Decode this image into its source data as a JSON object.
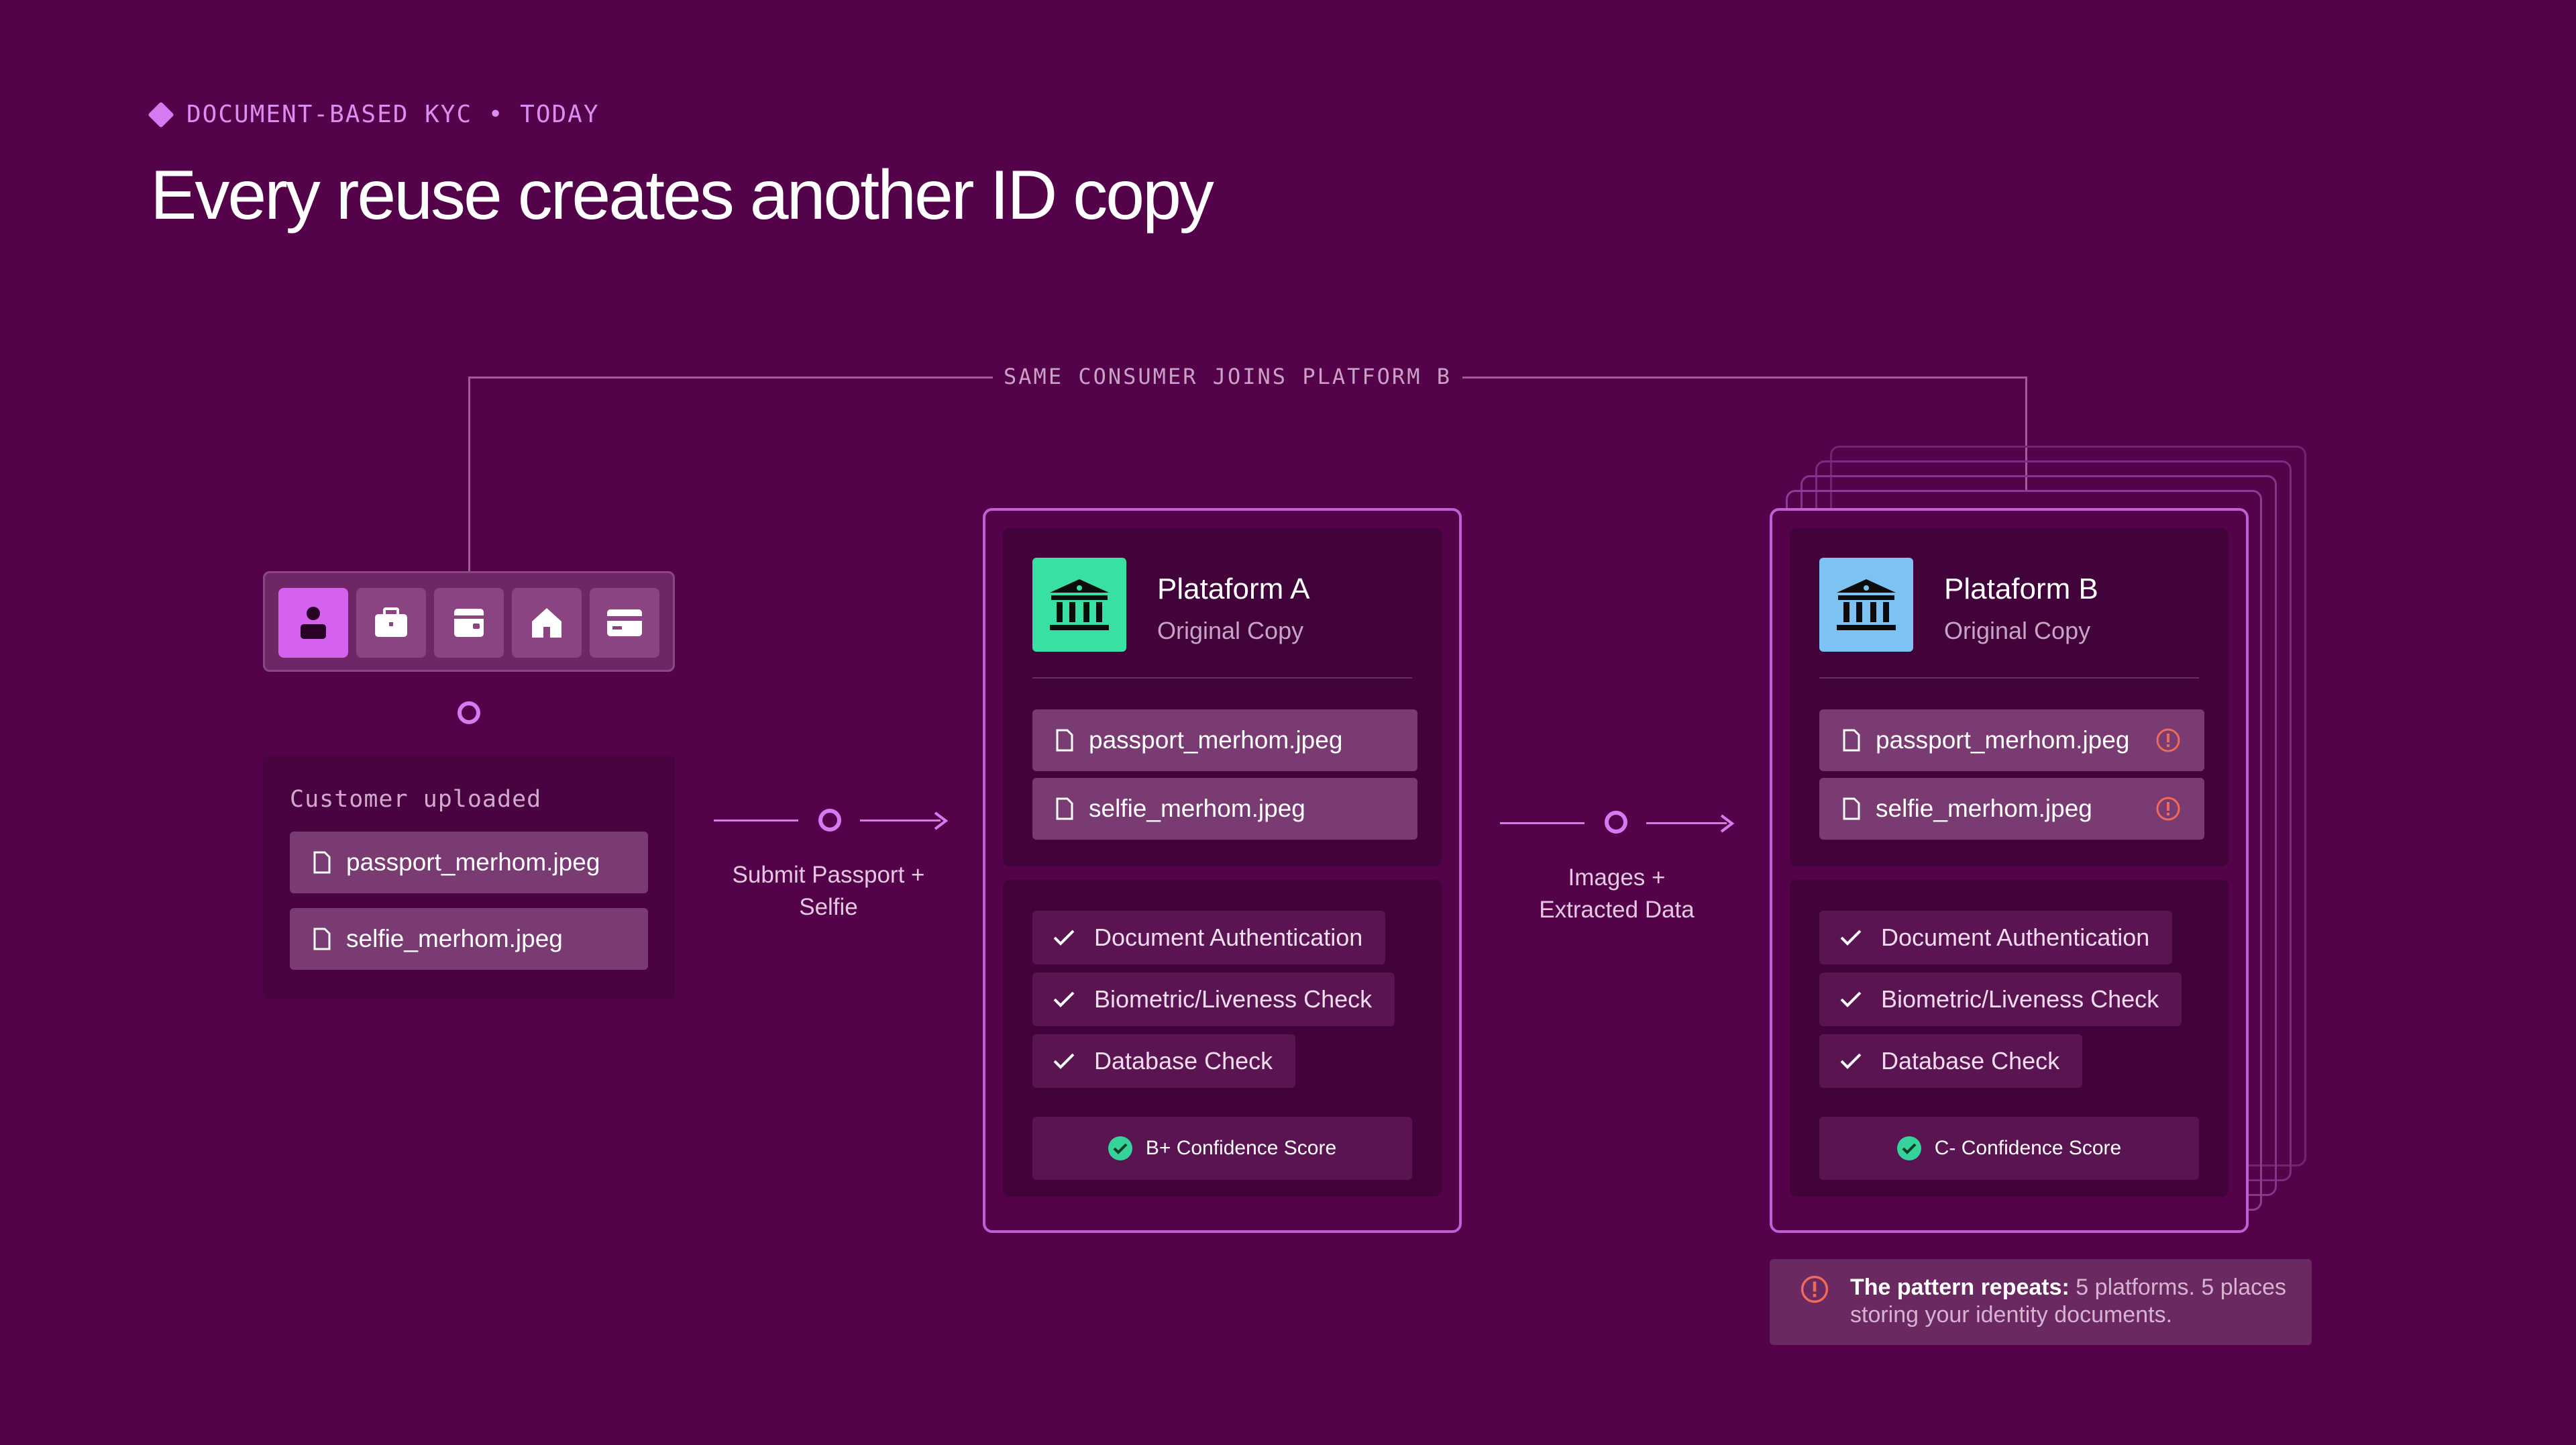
{
  "header": {
    "eyebrow": "DOCUMENT-BASED KYC • TODAY",
    "title": "Every reuse creates another ID copy"
  },
  "connector_label": "SAME CONSUMER JOINS PLATFORM B",
  "toolbar": {
    "items": [
      {
        "icon": "person-icon",
        "active": true
      },
      {
        "icon": "briefcase-icon",
        "active": false
      },
      {
        "icon": "wallet-icon",
        "active": false
      },
      {
        "icon": "home-icon",
        "active": false
      },
      {
        "icon": "credit-card-icon",
        "active": false
      }
    ]
  },
  "customer": {
    "label": "Customer uploaded",
    "files": [
      "passport_merhom.jpeg",
      "selfie_merhom.jpeg"
    ]
  },
  "arrows": {
    "submit_line1": "Submit Passport +",
    "submit_line2": "Selfie",
    "images_line1": "Images +",
    "images_line2": "Extracted Data"
  },
  "platform_a": {
    "name": "Plataform A",
    "subtitle": "Original Copy",
    "icon_color": "#38e0a4",
    "files": [
      "passport_merhom.jpeg",
      "selfie_merhom.jpeg"
    ],
    "checks": [
      "Document Authentication",
      "Biometric/Liveness Check",
      "Database Check"
    ],
    "score": "B+ Confidence Score"
  },
  "platform_b": {
    "name": "Plataform B",
    "subtitle": "Original Copy",
    "icon_color": "#7cc2f2",
    "files": [
      "passport_merhom.jpeg",
      "selfie_merhom.jpeg"
    ],
    "checks": [
      "Document Authentication",
      "Biometric/Liveness Check",
      "Database Check"
    ],
    "score": "C- Confidence Score"
  },
  "note": {
    "bold": "The pattern repeats:",
    "rest": " 5 platforms. 5 places storing your identity documents."
  },
  "colors": {
    "background": "#54034a",
    "accent": "#d561ef",
    "warning": "#f06a5a",
    "success": "#35d39a"
  }
}
